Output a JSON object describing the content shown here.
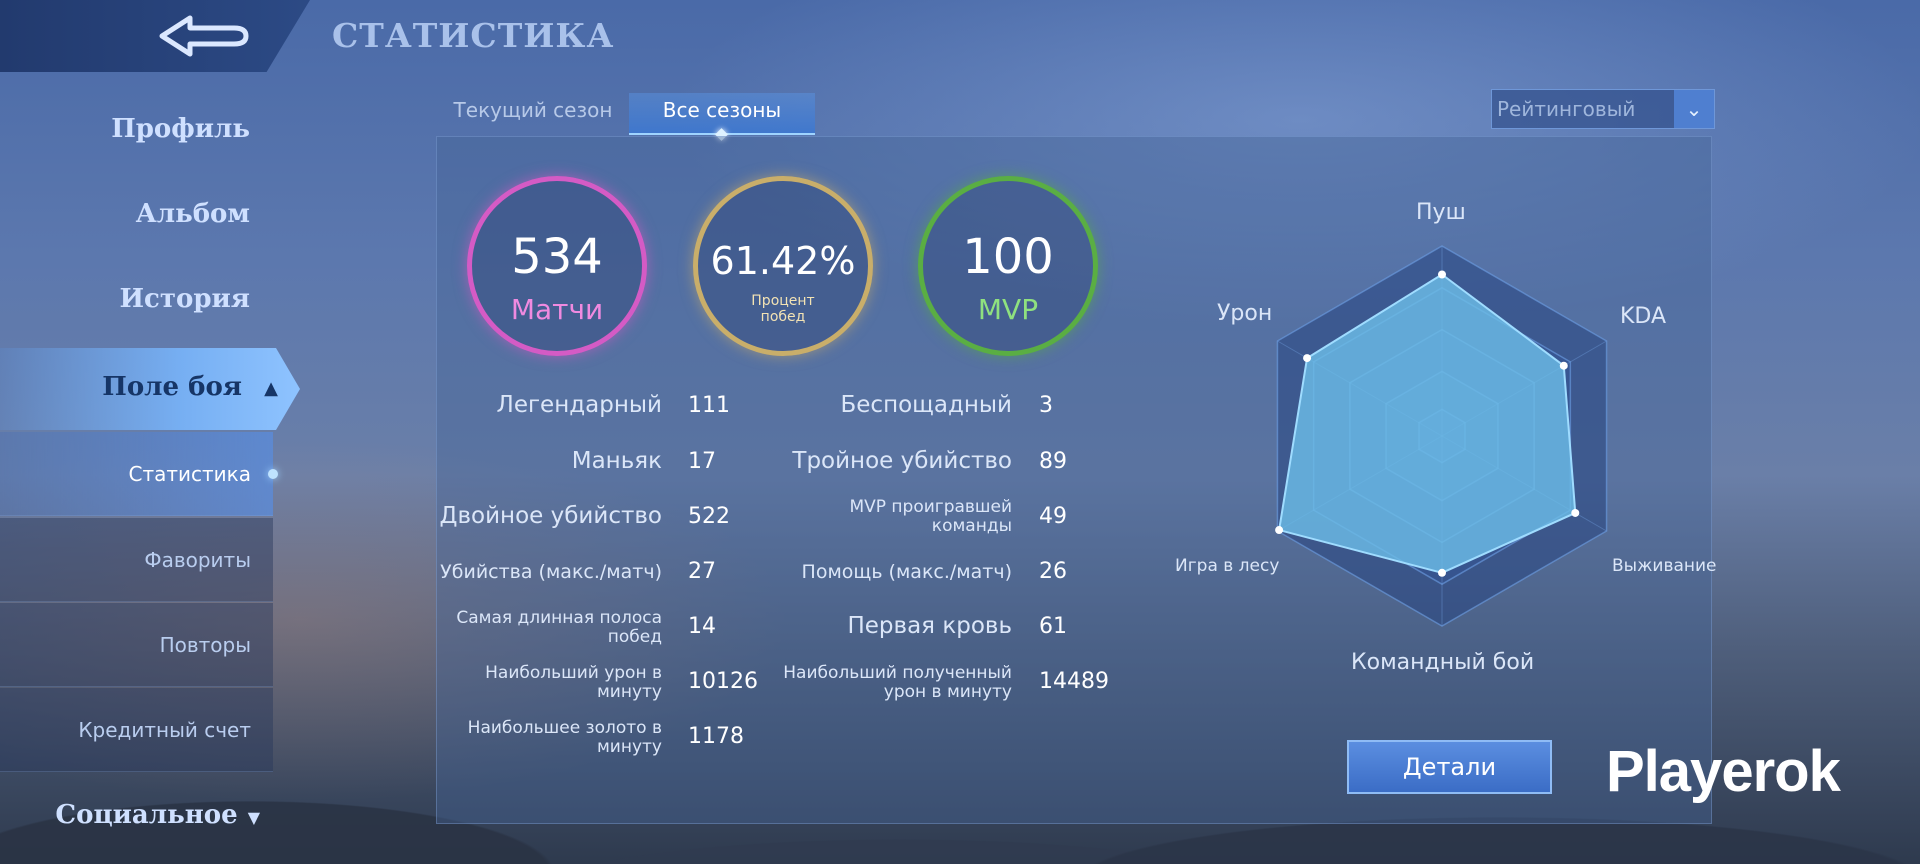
{
  "header": {
    "title": "СТАТИСТИКА"
  },
  "sidebar": {
    "profile": "Профиль",
    "album": "Альбом",
    "history": "История",
    "battlefield": "Поле боя",
    "sub_items": [
      "Статистика",
      "Фавориты",
      "Повторы",
      "Кредитный счет"
    ],
    "social": "Социальное"
  },
  "tabs": {
    "current": "Текущий сезон",
    "all": "Все сезоны"
  },
  "dropdown": {
    "value": "Рейтинговый"
  },
  "summary": {
    "matches": {
      "value": "534",
      "label": "Матчи"
    },
    "winrate": {
      "value": "61.42%",
      "label_line1": "Процент",
      "label_line2": "побед"
    },
    "mvp": {
      "value": "100",
      "label": "MVP"
    }
  },
  "stats_left": [
    {
      "label": "Легендарный",
      "value": "111"
    },
    {
      "label": "Маньяк",
      "value": "17"
    },
    {
      "label": "Двойное убийство",
      "value": "522"
    },
    {
      "label": "Убийства (макс./матч)",
      "value": "27"
    },
    {
      "label_line1": "Самая длинная полоса",
      "label_line2": "побед",
      "value": "14"
    },
    {
      "label_line1": "Наибольший урон в",
      "label_line2": "минуту",
      "value": "10126"
    },
    {
      "label_line1": "Наибольшее золото в",
      "label_line2": "минуту",
      "value": "1178"
    }
  ],
  "stats_right": [
    {
      "label": "Беспощадный",
      "value": "3"
    },
    {
      "label": "Тройное убийство",
      "value": "89"
    },
    {
      "label_line1": "MVP проигравшей",
      "label_line2": "команды",
      "value": "49"
    },
    {
      "label": "Помощь (макс./матч)",
      "value": "26"
    },
    {
      "label": "Первая кровь",
      "value": "61"
    },
    {
      "label_line1": "Наибольший полученный",
      "label_line2": "урон в минуту",
      "value": "14489"
    }
  ],
  "radar": {
    "labels": {
      "push": "Пуш",
      "kda": "KDA",
      "survival": "Выживание",
      "teamfight": "Командный бой",
      "jungle": "Игра в лесу",
      "damage": "Урон"
    },
    "values": {
      "push": 0.85,
      "kda": 0.74,
      "survival": 0.81,
      "teamfight": 0.72,
      "jungle": 0.99,
      "damage": 0.82
    },
    "fill_color": "#6bbce6"
  },
  "details_button": "Детали",
  "watermark": "Playerok"
}
